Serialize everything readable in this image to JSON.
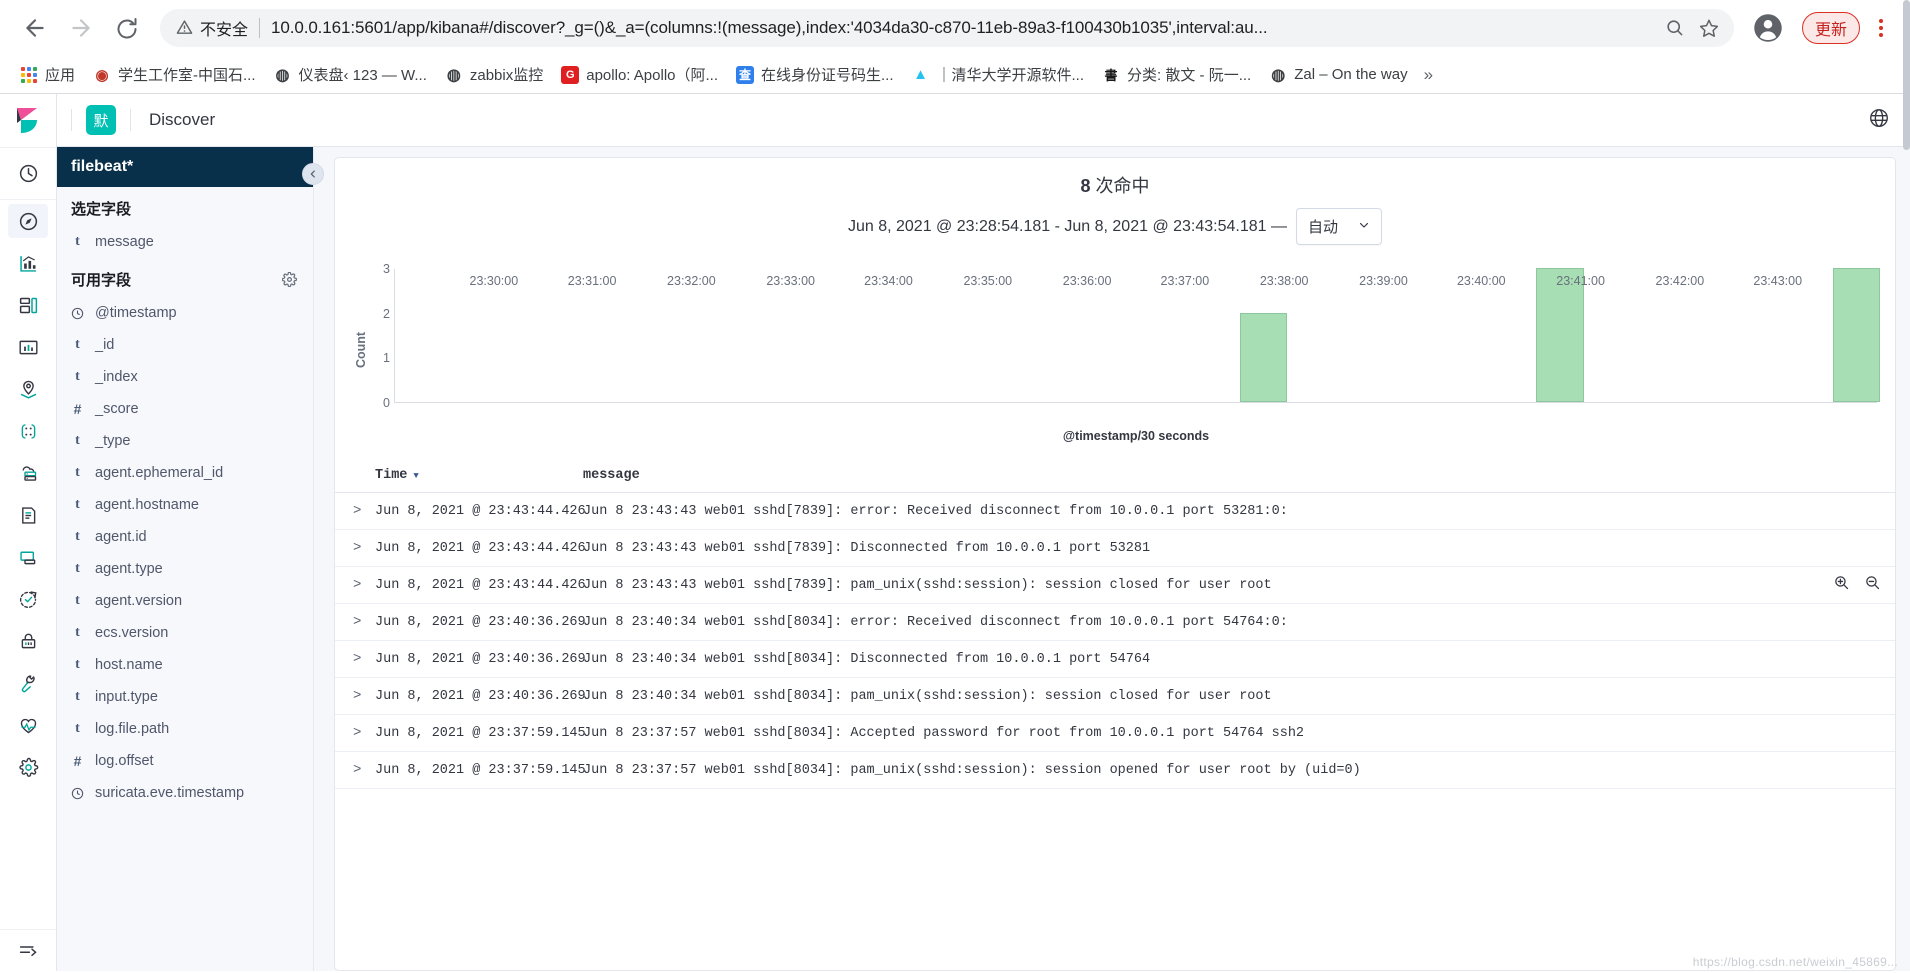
{
  "browser": {
    "security_label": "不安全",
    "url": "10.0.0.161:5601/app/kibana#/discover?_g=()&_a=(columns:!(message),index:'4034da30-c870-11eb-89a3-f100430b1035',interval:au...",
    "update_label": "更新",
    "apps_label": "应用",
    "bookmarks": [
      {
        "label": "学生工作室-中国石...",
        "icon": "red-circle-favicon",
        "color": "#c0392b",
        "glyph": "◉"
      },
      {
        "label": "仪表盘‹ 123 — W...",
        "icon": "globe-favicon",
        "color": "#3c4043",
        "glyph": "◍"
      },
      {
        "label": "zabbix监控",
        "icon": "globe-favicon",
        "color": "#3c4043",
        "glyph": "◍"
      },
      {
        "label": "apollo: Apollo（阿...",
        "icon": "g-favicon",
        "color": "#e02020",
        "glyph": "G"
      },
      {
        "label": "在线身份证号码生...",
        "icon": "blue-cha-favicon",
        "color": "#2f80ed",
        "glyph": "查"
      },
      {
        "label": "｜清华大学开源软件...",
        "icon": "bird-favicon",
        "color": "#27c1f0",
        "glyph": "🐦"
      },
      {
        "label": "分类: 散文 - 阮一...",
        "icon": "ink-favicon",
        "color": "#1a1a1a",
        "glyph": "書"
      },
      {
        "label": "Zal – On the way",
        "icon": "globe-favicon",
        "color": "#3c4043",
        "glyph": "◍"
      }
    ],
    "overflow_label": "»"
  },
  "kibana": {
    "space_badge": "默",
    "app_title": "Discover",
    "rail_items": [
      "recently-viewed-icon",
      "discover-icon",
      "visualize-icon",
      "dashboard-icon",
      "canvas-icon",
      "maps-icon",
      "machine-learning-icon",
      "infrastructure-icon",
      "logs-icon",
      "apm-icon",
      "uptime-icon",
      "siem-icon",
      "dev-tools-icon",
      "monitoring-icon",
      "management-icon",
      "collapse-nav-icon"
    ],
    "sidebar": {
      "index_pattern": "filebeat*",
      "selected_fields_label": "选定字段",
      "selected_fields": [
        {
          "type": "t",
          "name": "message"
        }
      ],
      "available_fields_label": "可用字段",
      "available_fields": [
        {
          "type": "clock",
          "name": "@timestamp"
        },
        {
          "type": "t",
          "name": "_id"
        },
        {
          "type": "t",
          "name": "_index"
        },
        {
          "type": "#",
          "name": "_score"
        },
        {
          "type": "t",
          "name": "_type"
        },
        {
          "type": "t",
          "name": "agent.ephemeral_id"
        },
        {
          "type": "t",
          "name": "agent.hostname"
        },
        {
          "type": "t",
          "name": "agent.id"
        },
        {
          "type": "t",
          "name": "agent.type"
        },
        {
          "type": "t",
          "name": "agent.version"
        },
        {
          "type": "t",
          "name": "ecs.version"
        },
        {
          "type": "t",
          "name": "host.name"
        },
        {
          "type": "t",
          "name": "input.type"
        },
        {
          "type": "t",
          "name": "log.file.path"
        },
        {
          "type": "#",
          "name": "log.offset"
        },
        {
          "type": "clock",
          "name": "suricata.eve.timestamp"
        }
      ]
    },
    "hits_count": "8",
    "hits_suffix": "次命中",
    "time_range": "Jun 8, 2021 @ 23:28:54.181 - Jun 8, 2021 @ 23:43:54.181 —",
    "interval_value": "自动",
    "table": {
      "col_time": "Time",
      "col_message": "message",
      "rows": [
        {
          "time": "Jun 8, 2021 @ 23:43:44.426",
          "message": "Jun  8 23:43:43 web01 sshd[7839]: error: Received disconnect from 10.0.0.1 port 53281:0:"
        },
        {
          "time": "Jun 8, 2021 @ 23:43:44.426",
          "message": "Jun  8 23:43:43 web01 sshd[7839]: Disconnected from 10.0.0.1 port 53281"
        },
        {
          "time": "Jun 8, 2021 @ 23:43:44.426",
          "message": "Jun  8 23:43:43 web01 sshd[7839]: pam_unix(sshd:session): session closed for user root"
        },
        {
          "time": "Jun 8, 2021 @ 23:40:36.269",
          "message": "Jun  8 23:40:34 web01 sshd[8034]: error: Received disconnect from 10.0.0.1 port 54764:0:"
        },
        {
          "time": "Jun 8, 2021 @ 23:40:36.269",
          "message": "Jun  8 23:40:34 web01 sshd[8034]: Disconnected from 10.0.0.1 port 54764"
        },
        {
          "time": "Jun 8, 2021 @ 23:40:36.269",
          "message": "Jun  8 23:40:34 web01 sshd[8034]: pam_unix(sshd:session): session closed for user root"
        },
        {
          "time": "Jun 8, 2021 @ 23:37:59.145",
          "message": "Jun  8 23:37:57 web01 sshd[8034]: Accepted password for root from 10.0.0.1 port 54764 ssh2"
        },
        {
          "time": "Jun 8, 2021 @ 23:37:59.145",
          "message": "Jun  8 23:37:57 web01 sshd[8034]: pam_unix(sshd:session): session opened for user root by (uid=0)"
        }
      ]
    },
    "watermark": "https://blog.csdn.net/weixin_45869..."
  },
  "chart_data": {
    "type": "bar",
    "title": "",
    "xlabel": "@timestamp/30 seconds",
    "ylabel": "Count",
    "ylim": [
      0,
      3
    ],
    "yticks": [
      0,
      1,
      2,
      3
    ],
    "xticks": [
      "23:30:00",
      "23:31:00",
      "23:32:00",
      "23:33:00",
      "23:34:00",
      "23:35:00",
      "23:36:00",
      "23:37:00",
      "23:38:00",
      "23:39:00",
      "23:40:00",
      "23:41:00",
      "23:42:00",
      "23:43:00"
    ],
    "x_start": "23:28:54",
    "x_end": "23:43:54",
    "bar_color": "#a7deb4",
    "grid": false,
    "categories": [
      "23:37:30",
      "23:40:30",
      "23:43:30"
    ],
    "values": [
      2,
      3,
      3
    ]
  }
}
